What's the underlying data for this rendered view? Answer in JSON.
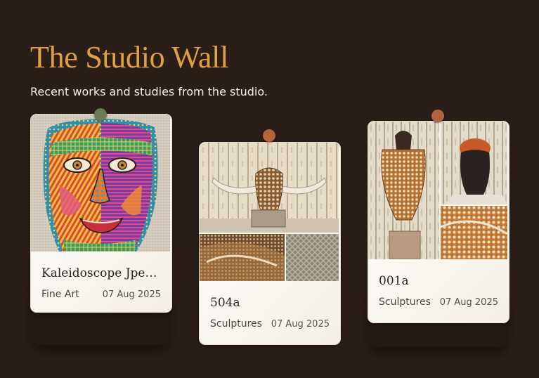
{
  "header": {
    "title": "The Studio Wall",
    "subtitle": "Recent works and studies from the studio."
  },
  "colors": {
    "background": "#2b1e19",
    "title": "#e0a040",
    "subtitle": "#f6efe6",
    "card": "#faf7f2"
  },
  "cards": [
    {
      "title": "Kaleidoscope Jpe…",
      "category": "Fine Art",
      "date": "07 Aug 2025",
      "pin_color": "#6f7a5b",
      "image": "colorful-face-painting"
    },
    {
      "title": "504a",
      "category": "Sculptures",
      "date": "07 Aug 2025",
      "pin_color": "#b7643f",
      "image": "beaded-bull-skull-collage"
    },
    {
      "title": "001a",
      "category": "Sculptures",
      "date": "07 Aug 2025",
      "pin_color": "#b4613f",
      "image": "beaded-figure-sculpture-collage"
    }
  ]
}
